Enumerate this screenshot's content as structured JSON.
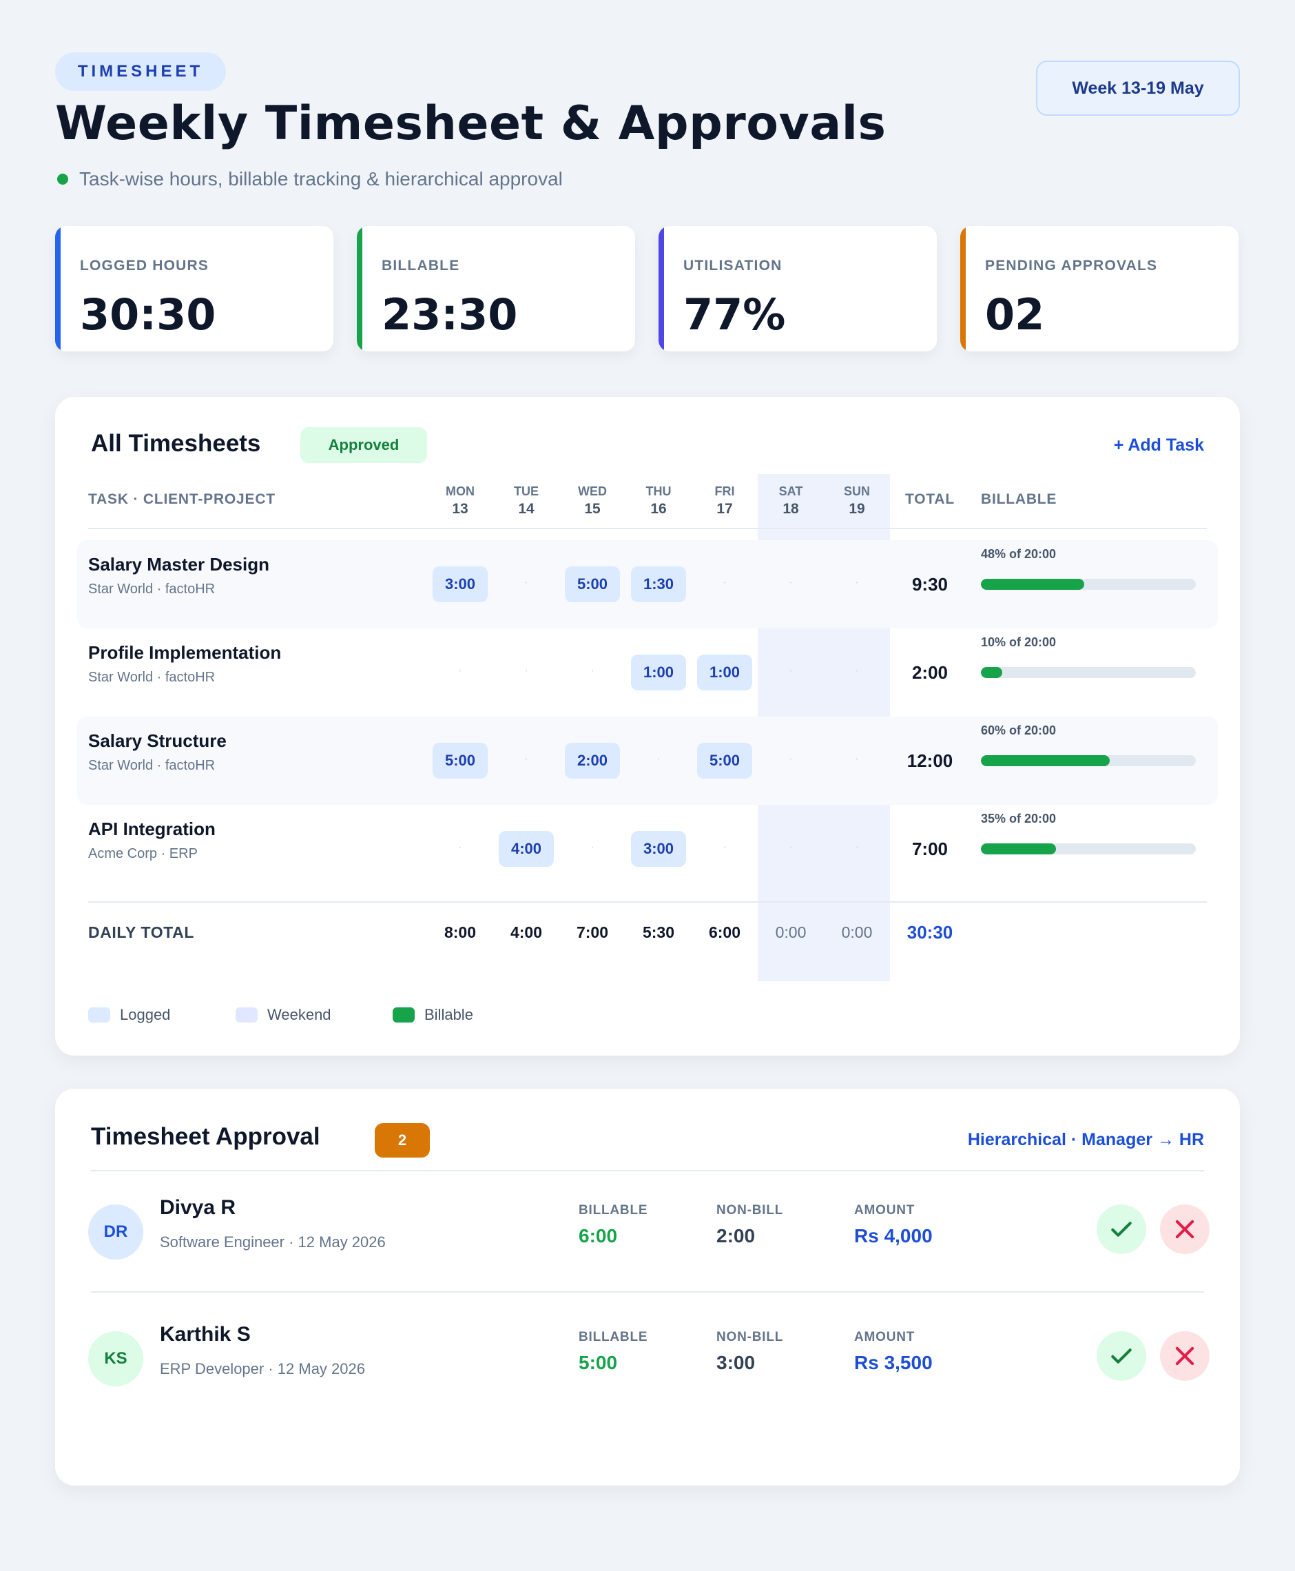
{
  "header": {
    "eyebrow": "TIMESHEET",
    "title": "Weekly Timesheet & Approvals",
    "subtitle": "Task-wise hours, billable tracking & hierarchical approval",
    "week": "Week 13-19 May"
  },
  "stats": [
    {
      "label": "LOGGED HOURS",
      "value": "30:30",
      "accent": "#2563eb"
    },
    {
      "label": "BILLABLE",
      "value": "23:30",
      "accent": "#16a34a"
    },
    {
      "label": "UTILISATION",
      "value": "77%",
      "accent": "#4f46e5"
    },
    {
      "label": "PENDING APPROVALS",
      "value": "02",
      "accent": "#d97706"
    }
  ],
  "timesheets": {
    "title": "All Timesheets",
    "status": "Approved",
    "add_task": "+ Add Task",
    "columns": {
      "task": "TASK · CLIENT-PROJECT",
      "total": "TOTAL",
      "billable": "BILLABLE"
    },
    "days": [
      {
        "name": "MON",
        "num": "13"
      },
      {
        "name": "TUE",
        "num": "14"
      },
      {
        "name": "WED",
        "num": "15"
      },
      {
        "name": "THU",
        "num": "16"
      },
      {
        "name": "FRI",
        "num": "17"
      },
      {
        "name": "SAT",
        "num": "18"
      },
      {
        "name": "SUN",
        "num": "19"
      }
    ],
    "empty_mark": "·",
    "rows": [
      {
        "task": "Salary Master Design",
        "client": "Star World · factoHR",
        "hours": [
          "3:00",
          "",
          "5:00",
          "1:30",
          "",
          "",
          ""
        ],
        "total": "9:30",
        "billable_label": "48% of 20:00",
        "billable_pct": 48
      },
      {
        "task": "Profile Implementation",
        "client": "Star World · factoHR",
        "hours": [
          "",
          "",
          "",
          "1:00",
          "1:00",
          "",
          ""
        ],
        "total": "2:00",
        "billable_label": "10% of 20:00",
        "billable_pct": 10
      },
      {
        "task": "Salary Structure",
        "client": "Star World · factoHR",
        "hours": [
          "5:00",
          "",
          "2:00",
          "",
          "5:00",
          "",
          ""
        ],
        "total": "12:00",
        "billable_label": "60% of 20:00",
        "billable_pct": 60
      },
      {
        "task": "API Integration",
        "client": "Acme Corp · ERP",
        "hours": [
          "",
          "4:00",
          "",
          "3:00",
          "",
          "",
          ""
        ],
        "total": "7:00",
        "billable_label": "35% of 20:00",
        "billable_pct": 35
      }
    ],
    "daily_total_label": "DAILY TOTAL",
    "daily_totals": [
      "8:00",
      "4:00",
      "7:00",
      "5:30",
      "6:00",
      "0:00",
      "0:00"
    ],
    "grand_total": "30:30",
    "legend": [
      {
        "label": "Logged",
        "color": "#dbeafe"
      },
      {
        "label": "Weekend",
        "color": "#e0e7ff"
      },
      {
        "label": "Billable",
        "color": "#16a34a"
      }
    ]
  },
  "approval": {
    "title": "Timesheet Approval",
    "count": "2",
    "flow": "Hierarchical · Manager → HR",
    "metric_labels": {
      "billable": "BILLABLE",
      "nonbill": "NON-BILL",
      "amount": "AMOUNT"
    },
    "items": [
      {
        "initials": "DR",
        "name": "Divya R",
        "role": "Software Engineer · 12 May 2026",
        "billable": "6:00",
        "nonbill": "2:00",
        "amount": "Rs 4,000",
        "avatar_bg": "#dbeafe",
        "avatar_fg": "#1d4ed8"
      },
      {
        "initials": "KS",
        "name": "Karthik S",
        "role": "ERP Developer · 12 May 2026",
        "billable": "5:00",
        "nonbill": "3:00",
        "amount": "Rs 3,500",
        "avatar_bg": "#dcfce7",
        "avatar_fg": "#15803d"
      }
    ]
  }
}
